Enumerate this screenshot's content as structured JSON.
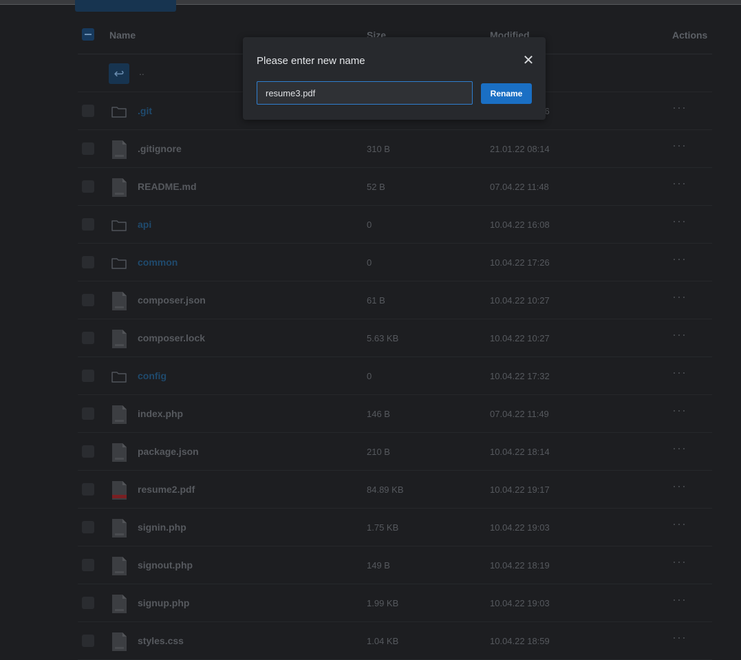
{
  "header": {
    "name": "Name",
    "size": "Size",
    "modified": "Modified",
    "actions": "Actions"
  },
  "parent_row": {
    "label": ".."
  },
  "files": [
    {
      "name": ".git",
      "type": "folder",
      "size": "",
      "modified": "10.04.22 17:26"
    },
    {
      "name": ".gitignore",
      "type": "file",
      "size": "310 B",
      "modified": "21.01.22 08:14"
    },
    {
      "name": "README.md",
      "type": "file",
      "size": "52 B",
      "modified": "07.04.22 11:48"
    },
    {
      "name": "api",
      "type": "folder",
      "size": "0",
      "modified": "10.04.22 16:08"
    },
    {
      "name": "common",
      "type": "folder",
      "size": "0",
      "modified": "10.04.22 17:26"
    },
    {
      "name": "composer.json",
      "type": "file",
      "size": "61 B",
      "modified": "10.04.22 10:27"
    },
    {
      "name": "composer.lock",
      "type": "file",
      "size": "5.63 KB",
      "modified": "10.04.22 10:27"
    },
    {
      "name": "config",
      "type": "folder",
      "size": "0",
      "modified": "10.04.22 17:32"
    },
    {
      "name": "index.php",
      "type": "file",
      "size": "146 B",
      "modified": "07.04.22 11:49"
    },
    {
      "name": "package.json",
      "type": "file",
      "size": "210 B",
      "modified": "10.04.22 18:14"
    },
    {
      "name": "resume2.pdf",
      "type": "pdf",
      "size": "84.89 KB",
      "modified": "10.04.22 19:17"
    },
    {
      "name": "signin.php",
      "type": "file",
      "size": "1.75 KB",
      "modified": "10.04.22 19:03"
    },
    {
      "name": "signout.php",
      "type": "file",
      "size": "149 B",
      "modified": "10.04.22 18:19"
    },
    {
      "name": "signup.php",
      "type": "file",
      "size": "1.99 KB",
      "modified": "10.04.22 19:03"
    },
    {
      "name": "styles.css",
      "type": "file",
      "size": "1.04 KB",
      "modified": "10.04.22 18:59"
    }
  ],
  "actions_glyph": "···",
  "modal": {
    "title": "Please enter new name",
    "input_value": "resume3.pdf",
    "rename_label": "Rename",
    "close_glyph": "✕"
  },
  "colors": {
    "accent": "#1a6fc4",
    "folder_text": "#1f4a6d",
    "pdf_badge": "#7a1f22"
  },
  "icons": {
    "folder": "folder-icon",
    "file": "file-icon",
    "pdf": "pdf-file-icon",
    "up": "return-arrow-icon",
    "close": "close-icon"
  }
}
